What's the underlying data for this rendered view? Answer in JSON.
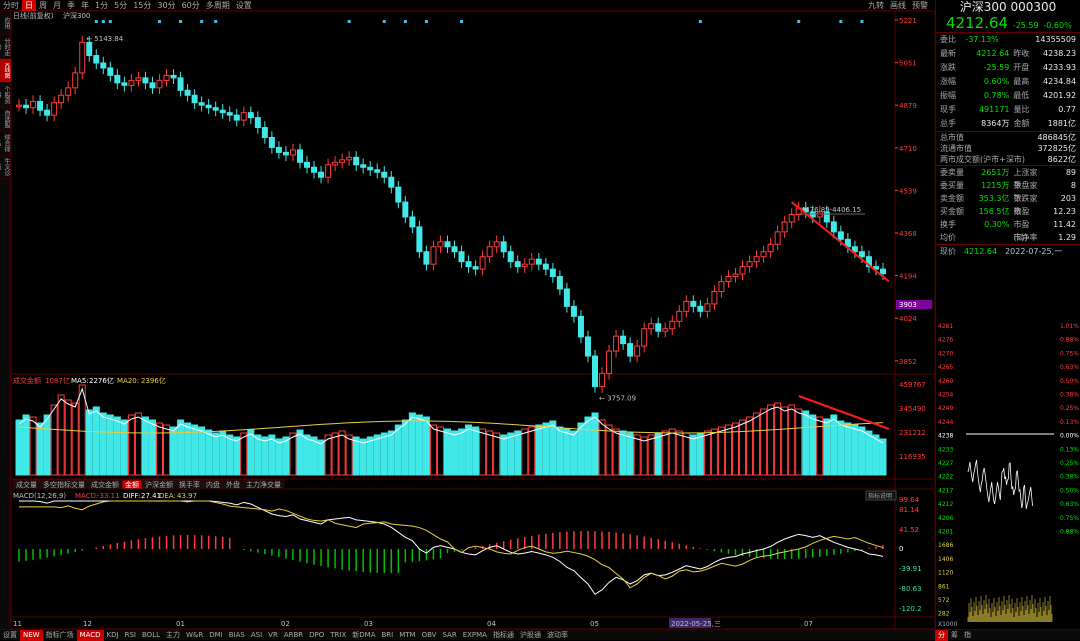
{
  "toolbar": {
    "periods": [
      "分时",
      "日",
      "周",
      "月",
      "季",
      "年",
      "1分",
      "5分",
      "15分",
      "30分",
      "60分",
      "多周期",
      "设置"
    ],
    "active_period": "日",
    "right_items": [
      "九转",
      "画线",
      "预警"
    ]
  },
  "left_rail": [
    "应用",
    "分时走势",
    "K线图",
    "个股资料",
    "自选股",
    "综合排名",
    "牛叉诊断"
  ],
  "chart": {
    "title_period": "日线(前复权)",
    "title_name": "沪深300",
    "high_label": "5143.84",
    "low_label": "3757.09",
    "range_label": "4476.89-4406.15",
    "price_ticks": [
      "5221",
      "5051",
      "4879",
      "4710",
      "4539",
      "4368",
      "4194",
      "4024",
      "3852"
    ],
    "current_price_tag": "3903",
    "vol_legend_name": "成交金额",
    "vol_legend_value": "1087亿",
    "vol_ma5_label": "MA5:",
    "vol_ma5_value": "2276亿",
    "vol_ma20_label": "MA20:",
    "vol_ma20_value": "2396亿",
    "vol_ticks": [
      "459767",
      "345490",
      "231212",
      "116935"
    ],
    "vol_tabs": [
      "成交量",
      "多空指标交量",
      "成交金额",
      "金额",
      "沪深金额",
      "换手率",
      "内盘",
      "外盘",
      "主力净交量"
    ],
    "vol_tabs_active": "金额",
    "macd_name": "MACD(12,26,9)",
    "macd_label": "MACD:",
    "macd_value": "-33.11",
    "diff_label": "DIFF:",
    "diff_value": "27.41",
    "dea_label": "DEA:",
    "dea_value": "43.97",
    "macd_btn": "指标说明",
    "macd_ticks": [
      "99.64",
      "81.14",
      "41.52",
      "0",
      "-39.91",
      "-80.63",
      "-120.2"
    ],
    "date_ticks": [
      "11",
      "12",
      "01",
      "02",
      "03",
      "04",
      "05",
      "2022-05-25,三",
      "07"
    ]
  },
  "bottom_bar": {
    "items": [
      "设置",
      "NEW",
      "指标广场",
      "MACD",
      "KDJ",
      "RSI",
      "BOLL",
      "主力",
      "W&R",
      "DMI",
      "BIAS",
      "ASI",
      "VR",
      "ARBR",
      "DPO",
      "TRIX",
      "新DMA",
      "BRI",
      "MTM",
      "OBV",
      "SAR",
      "EXPMA",
      "指标通",
      "沪股通",
      "波动率"
    ],
    "active": "MACD"
  },
  "right_panel": {
    "title": "沪深300 000300",
    "price": "4212.64",
    "change": "-25.59",
    "change_pct": "-0.60%",
    "rows": [
      {
        "l": "委比",
        "v": "-37.13%",
        "l2": "",
        "v2": "1435",
        "v3": "5509"
      },
      {
        "l": "最新",
        "v": "4212.64",
        "l2": "昨收",
        "v2": "4238.23"
      },
      {
        "l": "涨跌",
        "v": "-25.59",
        "l2": "开盘",
        "v2": "4233.93"
      },
      {
        "l": "涨幅",
        "v": "0.60%",
        "l2": "最高",
        "v2": "4234.84"
      },
      {
        "l": "振幅",
        "v": "0.78%",
        "l2": "最低",
        "v2": "4201.92"
      },
      {
        "l": "现手",
        "v": "491171",
        "l2": "量比",
        "v2": "0.77"
      },
      {
        "l": "总手",
        "v": "8364万",
        "l2": "金额",
        "v2": "1881亿"
      }
    ],
    "rows2": [
      {
        "l": "总市值",
        "v": "486845亿"
      },
      {
        "l": "流通市值",
        "v": "372825亿"
      },
      {
        "l": "两市成交额(沪市+深市)",
        "v": "8622亿"
      }
    ],
    "rows3": [
      {
        "l": "委卖量",
        "v": "2651万",
        "l2": "上涨家数",
        "v2": "89"
      },
      {
        "l": "委买量",
        "v": "1215万",
        "l2": "平盘家数",
        "v2": "8"
      },
      {
        "l": "卖金额",
        "v": "353.3亿",
        "l2": "下跌家数",
        "v2": "203"
      },
      {
        "l": "买金额",
        "v": "156.5亿",
        "l2": "市盈",
        "v2": "12.23"
      },
      {
        "l": "换手",
        "v": "0.30%",
        "l2": "市盈(动)",
        "v2": "11.42"
      },
      {
        "l": "均价",
        "v": "",
        "l2": "市净率",
        "v2": "1.29"
      }
    ],
    "now_label": "现价",
    "now_price": "4212.64",
    "now_date": "2022-07-25,一",
    "mini_left_ticks": [
      "4281",
      "4276",
      "4270",
      "4265",
      "4260",
      "4254",
      "4249",
      "4244",
      "4238",
      "4233",
      "4227",
      "4222",
      "4217",
      "4212",
      "4206",
      "4201",
      "1686",
      "1406",
      "1120",
      "861",
      "572",
      "282"
    ],
    "mini_right_ticks": [
      "1.01%",
      "0.88%",
      "0.75%",
      "0.63%",
      "0.50%",
      "0.38%",
      "0.25%",
      "0.13%",
      "0.00%",
      "0.13%",
      "0.25%",
      "0.38%",
      "0.50%",
      "0.63%",
      "0.75%",
      "0.88%"
    ],
    "mini_x_label": "X1000",
    "bottom_tabs": [
      "分",
      "筹",
      "指"
    ]
  }
}
